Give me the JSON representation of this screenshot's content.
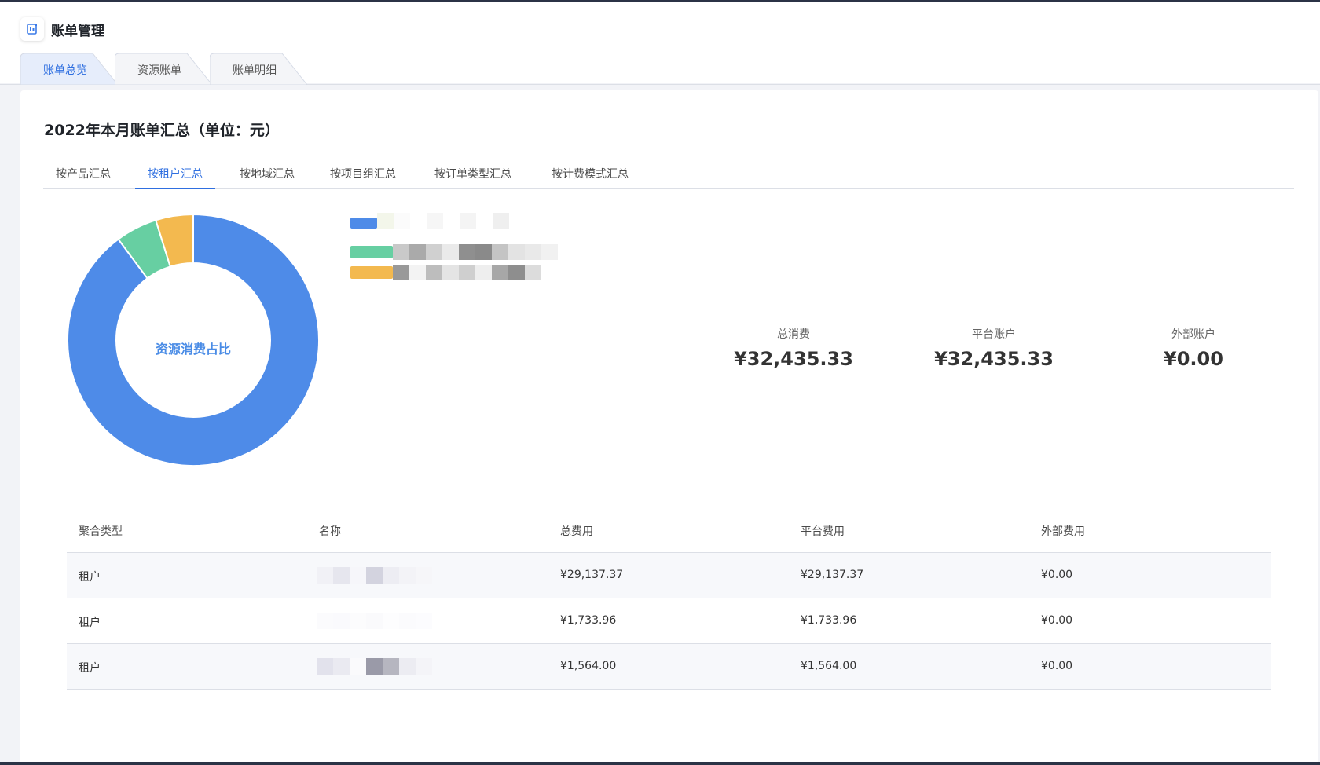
{
  "app": {
    "title": "账单管理",
    "icon": "bill-icon"
  },
  "page_tabs": [
    {
      "label": "账单总览",
      "active": true
    },
    {
      "label": "资源账单",
      "active": false
    },
    {
      "label": "账单明细",
      "active": false
    }
  ],
  "summary": {
    "title": "2022年本月账单汇总（单位：元）",
    "sub_tabs": [
      {
        "label": "按产品汇总",
        "active": false
      },
      {
        "label": "按租户汇总",
        "active": true
      },
      {
        "label": "按地域汇总",
        "active": false
      },
      {
        "label": "按项目组汇总",
        "active": false
      },
      {
        "label": "按订单类型汇总",
        "active": false
      },
      {
        "label": "按计费模式汇总",
        "active": false
      }
    ]
  },
  "chart_data": {
    "type": "pie",
    "title": "资源消费占比",
    "labels": [
      "",
      "",
      ""
    ],
    "values": [
      29137.37,
      1733.96,
      1564.0
    ],
    "colors": [
      "#4e8be8",
      "#67cfa2",
      "#f3b94f"
    ]
  },
  "stats": [
    {
      "label": "总消费",
      "value": "¥32,435.33"
    },
    {
      "label": "平台账户",
      "value": "¥32,435.33"
    },
    {
      "label": "外部账户",
      "value": "¥0.00"
    }
  ],
  "table": {
    "headers": [
      "聚合类型",
      "名称",
      "总费用",
      "平台费用",
      "外部费用"
    ],
    "rows": [
      [
        "租户",
        "",
        "¥29,137.37",
        "¥29,137.37",
        "¥0.00"
      ],
      [
        "租户",
        "",
        "¥1,733.96",
        "¥1,733.96",
        "¥0.00"
      ],
      [
        "租户",
        "",
        "¥1,564.00",
        "¥1,564.00",
        "¥0.00"
      ]
    ]
  }
}
